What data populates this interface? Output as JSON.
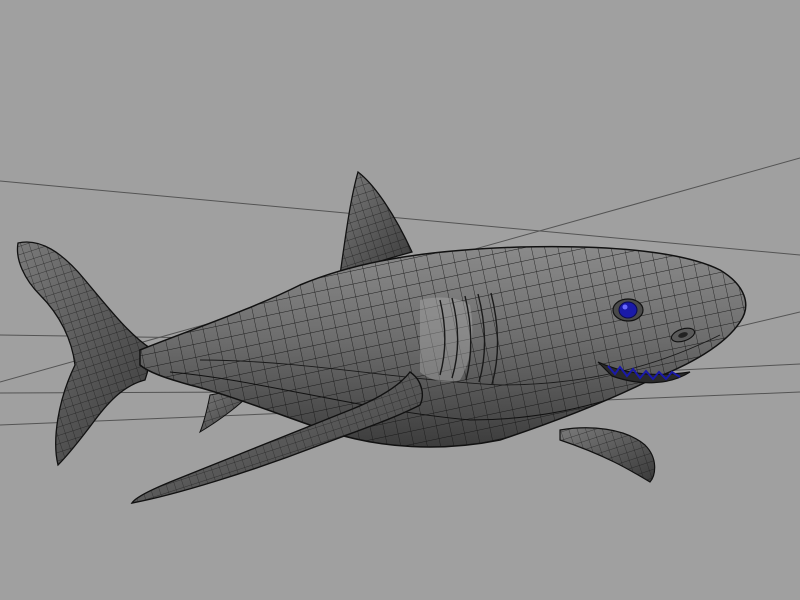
{
  "viewport": {
    "background": "#a0a0a0",
    "panel": "perspective",
    "display_mode": "wireframe-on-shaded"
  },
  "scene": {
    "object": "shark",
    "surface_color": "#6f6f6f",
    "wireframe_color": "#111111",
    "selection_highlight_color": "#1a1aa8",
    "highlighted_parts": [
      "eye",
      "teeth"
    ]
  },
  "grid": {
    "visible": true,
    "line_color": "#545454"
  }
}
